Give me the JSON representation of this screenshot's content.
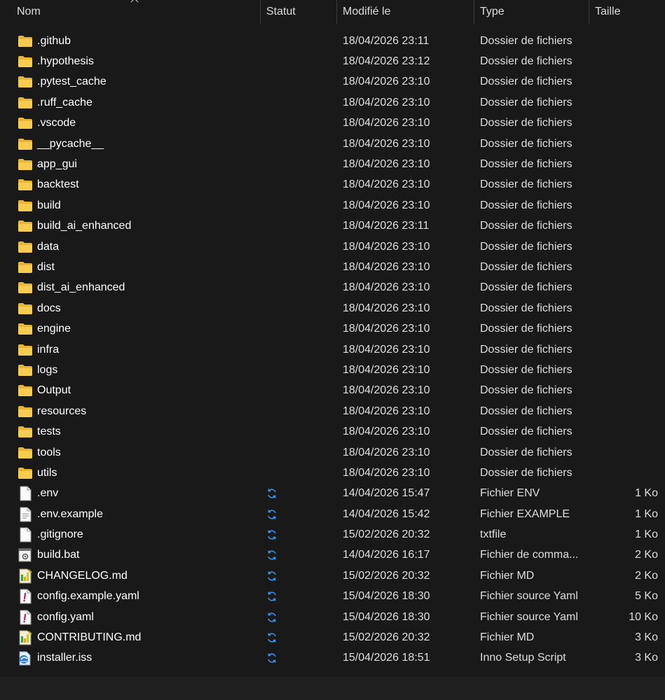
{
  "columns": {
    "name": "Nom",
    "status": "Statut",
    "modified": "Modifié le",
    "type": "Type",
    "size": "Taille"
  },
  "colors": {
    "background": "#191919",
    "folder": "#F4C543",
    "sync": "#3B8EEA"
  },
  "rows": [
    {
      "name": ".github",
      "icon": "folder-icon",
      "sync": false,
      "date": "18/04/2026 23:11",
      "type": "Dossier de fichiers",
      "size": ""
    },
    {
      "name": ".hypothesis",
      "icon": "folder-icon",
      "sync": false,
      "date": "18/04/2026 23:12",
      "type": "Dossier de fichiers",
      "size": ""
    },
    {
      "name": ".pytest_cache",
      "icon": "folder-icon",
      "sync": false,
      "date": "18/04/2026 23:10",
      "type": "Dossier de fichiers",
      "size": ""
    },
    {
      "name": ".ruff_cache",
      "icon": "folder-icon",
      "sync": false,
      "date": "18/04/2026 23:10",
      "type": "Dossier de fichiers",
      "size": ""
    },
    {
      "name": ".vscode",
      "icon": "folder-icon",
      "sync": false,
      "date": "18/04/2026 23:10",
      "type": "Dossier de fichiers",
      "size": ""
    },
    {
      "name": "__pycache__",
      "icon": "folder-icon",
      "sync": false,
      "date": "18/04/2026 23:10",
      "type": "Dossier de fichiers",
      "size": ""
    },
    {
      "name": "app_gui",
      "icon": "folder-icon",
      "sync": false,
      "date": "18/04/2026 23:10",
      "type": "Dossier de fichiers",
      "size": ""
    },
    {
      "name": "backtest",
      "icon": "folder-icon",
      "sync": false,
      "date": "18/04/2026 23:10",
      "type": "Dossier de fichiers",
      "size": ""
    },
    {
      "name": "build",
      "icon": "folder-icon",
      "sync": false,
      "date": "18/04/2026 23:10",
      "type": "Dossier de fichiers",
      "size": ""
    },
    {
      "name": "build_ai_enhanced",
      "icon": "folder-icon",
      "sync": false,
      "date": "18/04/2026 23:11",
      "type": "Dossier de fichiers",
      "size": ""
    },
    {
      "name": "data",
      "icon": "folder-icon",
      "sync": false,
      "date": "18/04/2026 23:10",
      "type": "Dossier de fichiers",
      "size": ""
    },
    {
      "name": "dist",
      "icon": "folder-icon",
      "sync": false,
      "date": "18/04/2026 23:10",
      "type": "Dossier de fichiers",
      "size": ""
    },
    {
      "name": "dist_ai_enhanced",
      "icon": "folder-icon",
      "sync": false,
      "date": "18/04/2026 23:10",
      "type": "Dossier de fichiers",
      "size": ""
    },
    {
      "name": "docs",
      "icon": "folder-icon",
      "sync": false,
      "date": "18/04/2026 23:10",
      "type": "Dossier de fichiers",
      "size": ""
    },
    {
      "name": "engine",
      "icon": "folder-icon",
      "sync": false,
      "date": "18/04/2026 23:10",
      "type": "Dossier de fichiers",
      "size": ""
    },
    {
      "name": "infra",
      "icon": "folder-icon",
      "sync": false,
      "date": "18/04/2026 23:10",
      "type": "Dossier de fichiers",
      "size": ""
    },
    {
      "name": "logs",
      "icon": "folder-icon",
      "sync": false,
      "date": "18/04/2026 23:10",
      "type": "Dossier de fichiers",
      "size": ""
    },
    {
      "name": "Output",
      "icon": "folder-icon",
      "sync": false,
      "date": "18/04/2026 23:10",
      "type": "Dossier de fichiers",
      "size": ""
    },
    {
      "name": "resources",
      "icon": "folder-icon",
      "sync": false,
      "date": "18/04/2026 23:10",
      "type": "Dossier de fichiers",
      "size": ""
    },
    {
      "name": "tests",
      "icon": "folder-icon",
      "sync": false,
      "date": "18/04/2026 23:10",
      "type": "Dossier de fichiers",
      "size": ""
    },
    {
      "name": "tools",
      "icon": "folder-icon",
      "sync": false,
      "date": "18/04/2026 23:10",
      "type": "Dossier de fichiers",
      "size": ""
    },
    {
      "name": "utils",
      "icon": "folder-icon",
      "sync": false,
      "date": "18/04/2026 23:10",
      "type": "Dossier de fichiers",
      "size": ""
    },
    {
      "name": ".env",
      "icon": "blank-file-icon",
      "sync": true,
      "date": "14/04/2026 15:47",
      "type": "Fichier ENV",
      "size": "1 Ko"
    },
    {
      "name": ".env.example",
      "icon": "text-file-icon",
      "sync": true,
      "date": "14/04/2026 15:42",
      "type": "Fichier EXAMPLE",
      "size": "1 Ko"
    },
    {
      "name": ".gitignore",
      "icon": "blank-file-icon",
      "sync": true,
      "date": "15/02/2026 20:32",
      "type": "txtfile",
      "size": "1 Ko"
    },
    {
      "name": "build.bat",
      "icon": "batch-file-icon",
      "sync": true,
      "date": "14/04/2026 16:17",
      "type": "Fichier de comma...",
      "size": "2 Ko"
    },
    {
      "name": "CHANGELOG.md",
      "icon": "markdown-file-icon",
      "sync": true,
      "date": "15/02/2026 20:32",
      "type": "Fichier MD",
      "size": "2 Ko"
    },
    {
      "name": "config.example.yaml",
      "icon": "yaml-file-icon",
      "sync": true,
      "date": "15/04/2026 18:30",
      "type": "Fichier source Yaml",
      "size": "5 Ko"
    },
    {
      "name": "config.yaml",
      "icon": "yaml-file-icon",
      "sync": true,
      "date": "15/04/2026 18:30",
      "type": "Fichier source Yaml",
      "size": "10 Ko"
    },
    {
      "name": "CONTRIBUTING.md",
      "icon": "markdown-file-icon",
      "sync": true,
      "date": "15/02/2026 20:32",
      "type": "Fichier MD",
      "size": "3 Ko"
    },
    {
      "name": "installer.iss",
      "icon": "inno-setup-icon",
      "sync": true,
      "date": "15/04/2026 18:51",
      "type": "Inno Setup Script",
      "size": "3 Ko"
    }
  ]
}
